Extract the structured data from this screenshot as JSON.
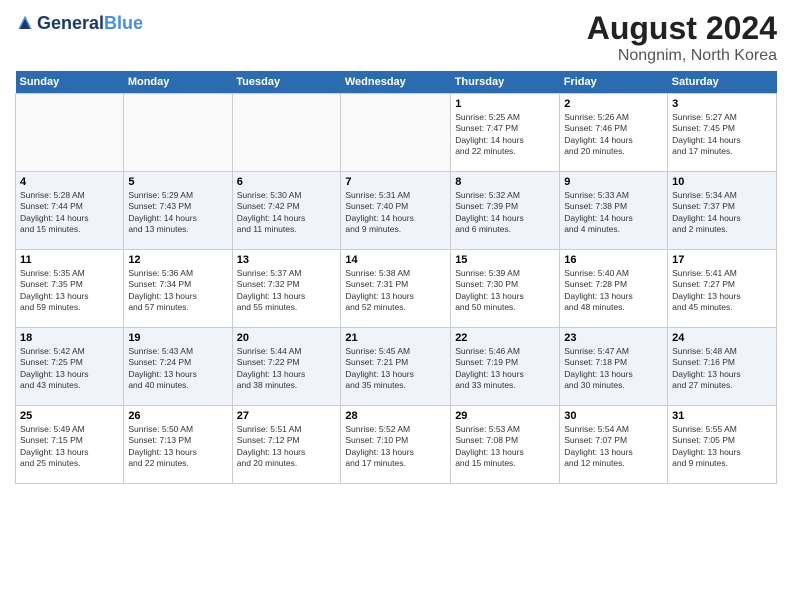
{
  "header": {
    "logo_line1": "General",
    "logo_line2": "Blue",
    "title": "August 2024",
    "subtitle": "Nongnim, North Korea"
  },
  "weekdays": [
    "Sunday",
    "Monday",
    "Tuesday",
    "Wednesday",
    "Thursday",
    "Friday",
    "Saturday"
  ],
  "weeks": [
    [
      {
        "day": "",
        "info": ""
      },
      {
        "day": "",
        "info": ""
      },
      {
        "day": "",
        "info": ""
      },
      {
        "day": "",
        "info": ""
      },
      {
        "day": "1",
        "info": "Sunrise: 5:25 AM\nSunset: 7:47 PM\nDaylight: 14 hours\nand 22 minutes."
      },
      {
        "day": "2",
        "info": "Sunrise: 5:26 AM\nSunset: 7:46 PM\nDaylight: 14 hours\nand 20 minutes."
      },
      {
        "day": "3",
        "info": "Sunrise: 5:27 AM\nSunset: 7:45 PM\nDaylight: 14 hours\nand 17 minutes."
      }
    ],
    [
      {
        "day": "4",
        "info": "Sunrise: 5:28 AM\nSunset: 7:44 PM\nDaylight: 14 hours\nand 15 minutes."
      },
      {
        "day": "5",
        "info": "Sunrise: 5:29 AM\nSunset: 7:43 PM\nDaylight: 14 hours\nand 13 minutes."
      },
      {
        "day": "6",
        "info": "Sunrise: 5:30 AM\nSunset: 7:42 PM\nDaylight: 14 hours\nand 11 minutes."
      },
      {
        "day": "7",
        "info": "Sunrise: 5:31 AM\nSunset: 7:40 PM\nDaylight: 14 hours\nand 9 minutes."
      },
      {
        "day": "8",
        "info": "Sunrise: 5:32 AM\nSunset: 7:39 PM\nDaylight: 14 hours\nand 6 minutes."
      },
      {
        "day": "9",
        "info": "Sunrise: 5:33 AM\nSunset: 7:38 PM\nDaylight: 14 hours\nand 4 minutes."
      },
      {
        "day": "10",
        "info": "Sunrise: 5:34 AM\nSunset: 7:37 PM\nDaylight: 14 hours\nand 2 minutes."
      }
    ],
    [
      {
        "day": "11",
        "info": "Sunrise: 5:35 AM\nSunset: 7:35 PM\nDaylight: 13 hours\nand 59 minutes."
      },
      {
        "day": "12",
        "info": "Sunrise: 5:36 AM\nSunset: 7:34 PM\nDaylight: 13 hours\nand 57 minutes."
      },
      {
        "day": "13",
        "info": "Sunrise: 5:37 AM\nSunset: 7:32 PM\nDaylight: 13 hours\nand 55 minutes."
      },
      {
        "day": "14",
        "info": "Sunrise: 5:38 AM\nSunset: 7:31 PM\nDaylight: 13 hours\nand 52 minutes."
      },
      {
        "day": "15",
        "info": "Sunrise: 5:39 AM\nSunset: 7:30 PM\nDaylight: 13 hours\nand 50 minutes."
      },
      {
        "day": "16",
        "info": "Sunrise: 5:40 AM\nSunset: 7:28 PM\nDaylight: 13 hours\nand 48 minutes."
      },
      {
        "day": "17",
        "info": "Sunrise: 5:41 AM\nSunset: 7:27 PM\nDaylight: 13 hours\nand 45 minutes."
      }
    ],
    [
      {
        "day": "18",
        "info": "Sunrise: 5:42 AM\nSunset: 7:25 PM\nDaylight: 13 hours\nand 43 minutes."
      },
      {
        "day": "19",
        "info": "Sunrise: 5:43 AM\nSunset: 7:24 PM\nDaylight: 13 hours\nand 40 minutes."
      },
      {
        "day": "20",
        "info": "Sunrise: 5:44 AM\nSunset: 7:22 PM\nDaylight: 13 hours\nand 38 minutes."
      },
      {
        "day": "21",
        "info": "Sunrise: 5:45 AM\nSunset: 7:21 PM\nDaylight: 13 hours\nand 35 minutes."
      },
      {
        "day": "22",
        "info": "Sunrise: 5:46 AM\nSunset: 7:19 PM\nDaylight: 13 hours\nand 33 minutes."
      },
      {
        "day": "23",
        "info": "Sunrise: 5:47 AM\nSunset: 7:18 PM\nDaylight: 13 hours\nand 30 minutes."
      },
      {
        "day": "24",
        "info": "Sunrise: 5:48 AM\nSunset: 7:16 PM\nDaylight: 13 hours\nand 27 minutes."
      }
    ],
    [
      {
        "day": "25",
        "info": "Sunrise: 5:49 AM\nSunset: 7:15 PM\nDaylight: 13 hours\nand 25 minutes."
      },
      {
        "day": "26",
        "info": "Sunrise: 5:50 AM\nSunset: 7:13 PM\nDaylight: 13 hours\nand 22 minutes."
      },
      {
        "day": "27",
        "info": "Sunrise: 5:51 AM\nSunset: 7:12 PM\nDaylight: 13 hours\nand 20 minutes."
      },
      {
        "day": "28",
        "info": "Sunrise: 5:52 AM\nSunset: 7:10 PM\nDaylight: 13 hours\nand 17 minutes."
      },
      {
        "day": "29",
        "info": "Sunrise: 5:53 AM\nSunset: 7:08 PM\nDaylight: 13 hours\nand 15 minutes."
      },
      {
        "day": "30",
        "info": "Sunrise: 5:54 AM\nSunset: 7:07 PM\nDaylight: 13 hours\nand 12 minutes."
      },
      {
        "day": "31",
        "info": "Sunrise: 5:55 AM\nSunset: 7:05 PM\nDaylight: 13 hours\nand 9 minutes."
      }
    ]
  ]
}
